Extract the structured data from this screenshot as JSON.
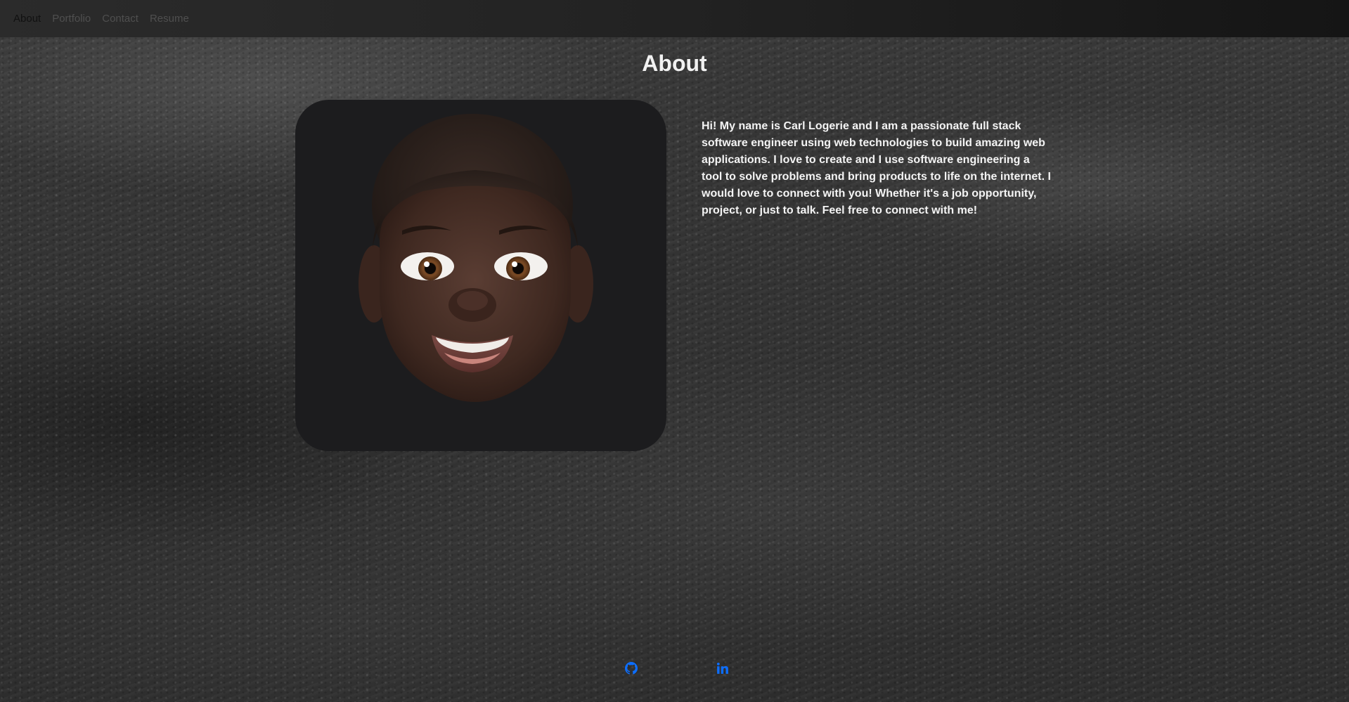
{
  "nav": {
    "items": [
      {
        "label": "About",
        "active": true
      },
      {
        "label": "Portfolio",
        "active": false
      },
      {
        "label": "Contact",
        "active": false
      },
      {
        "label": "Resume",
        "active": false
      }
    ]
  },
  "page": {
    "title": "About"
  },
  "bio": {
    "text": "Hi! My name is Carl Logerie and I am a passionate full stack software engineer using web technologies to build amazing web applications. I love to create and I use software engineering a tool to solve problems and bring products to life on the internet. I would love to connect with you! Whether it's a job opportunity, project, or just to talk. Feel free to connect with me!"
  },
  "footer": {
    "links": [
      {
        "icon": "github-icon"
      },
      {
        "icon": "linkedin-icon"
      }
    ]
  },
  "colors": {
    "accent_link": "#0d6efd",
    "nav_active": "#111111",
    "nav_inactive": "#4f4f4f"
  }
}
